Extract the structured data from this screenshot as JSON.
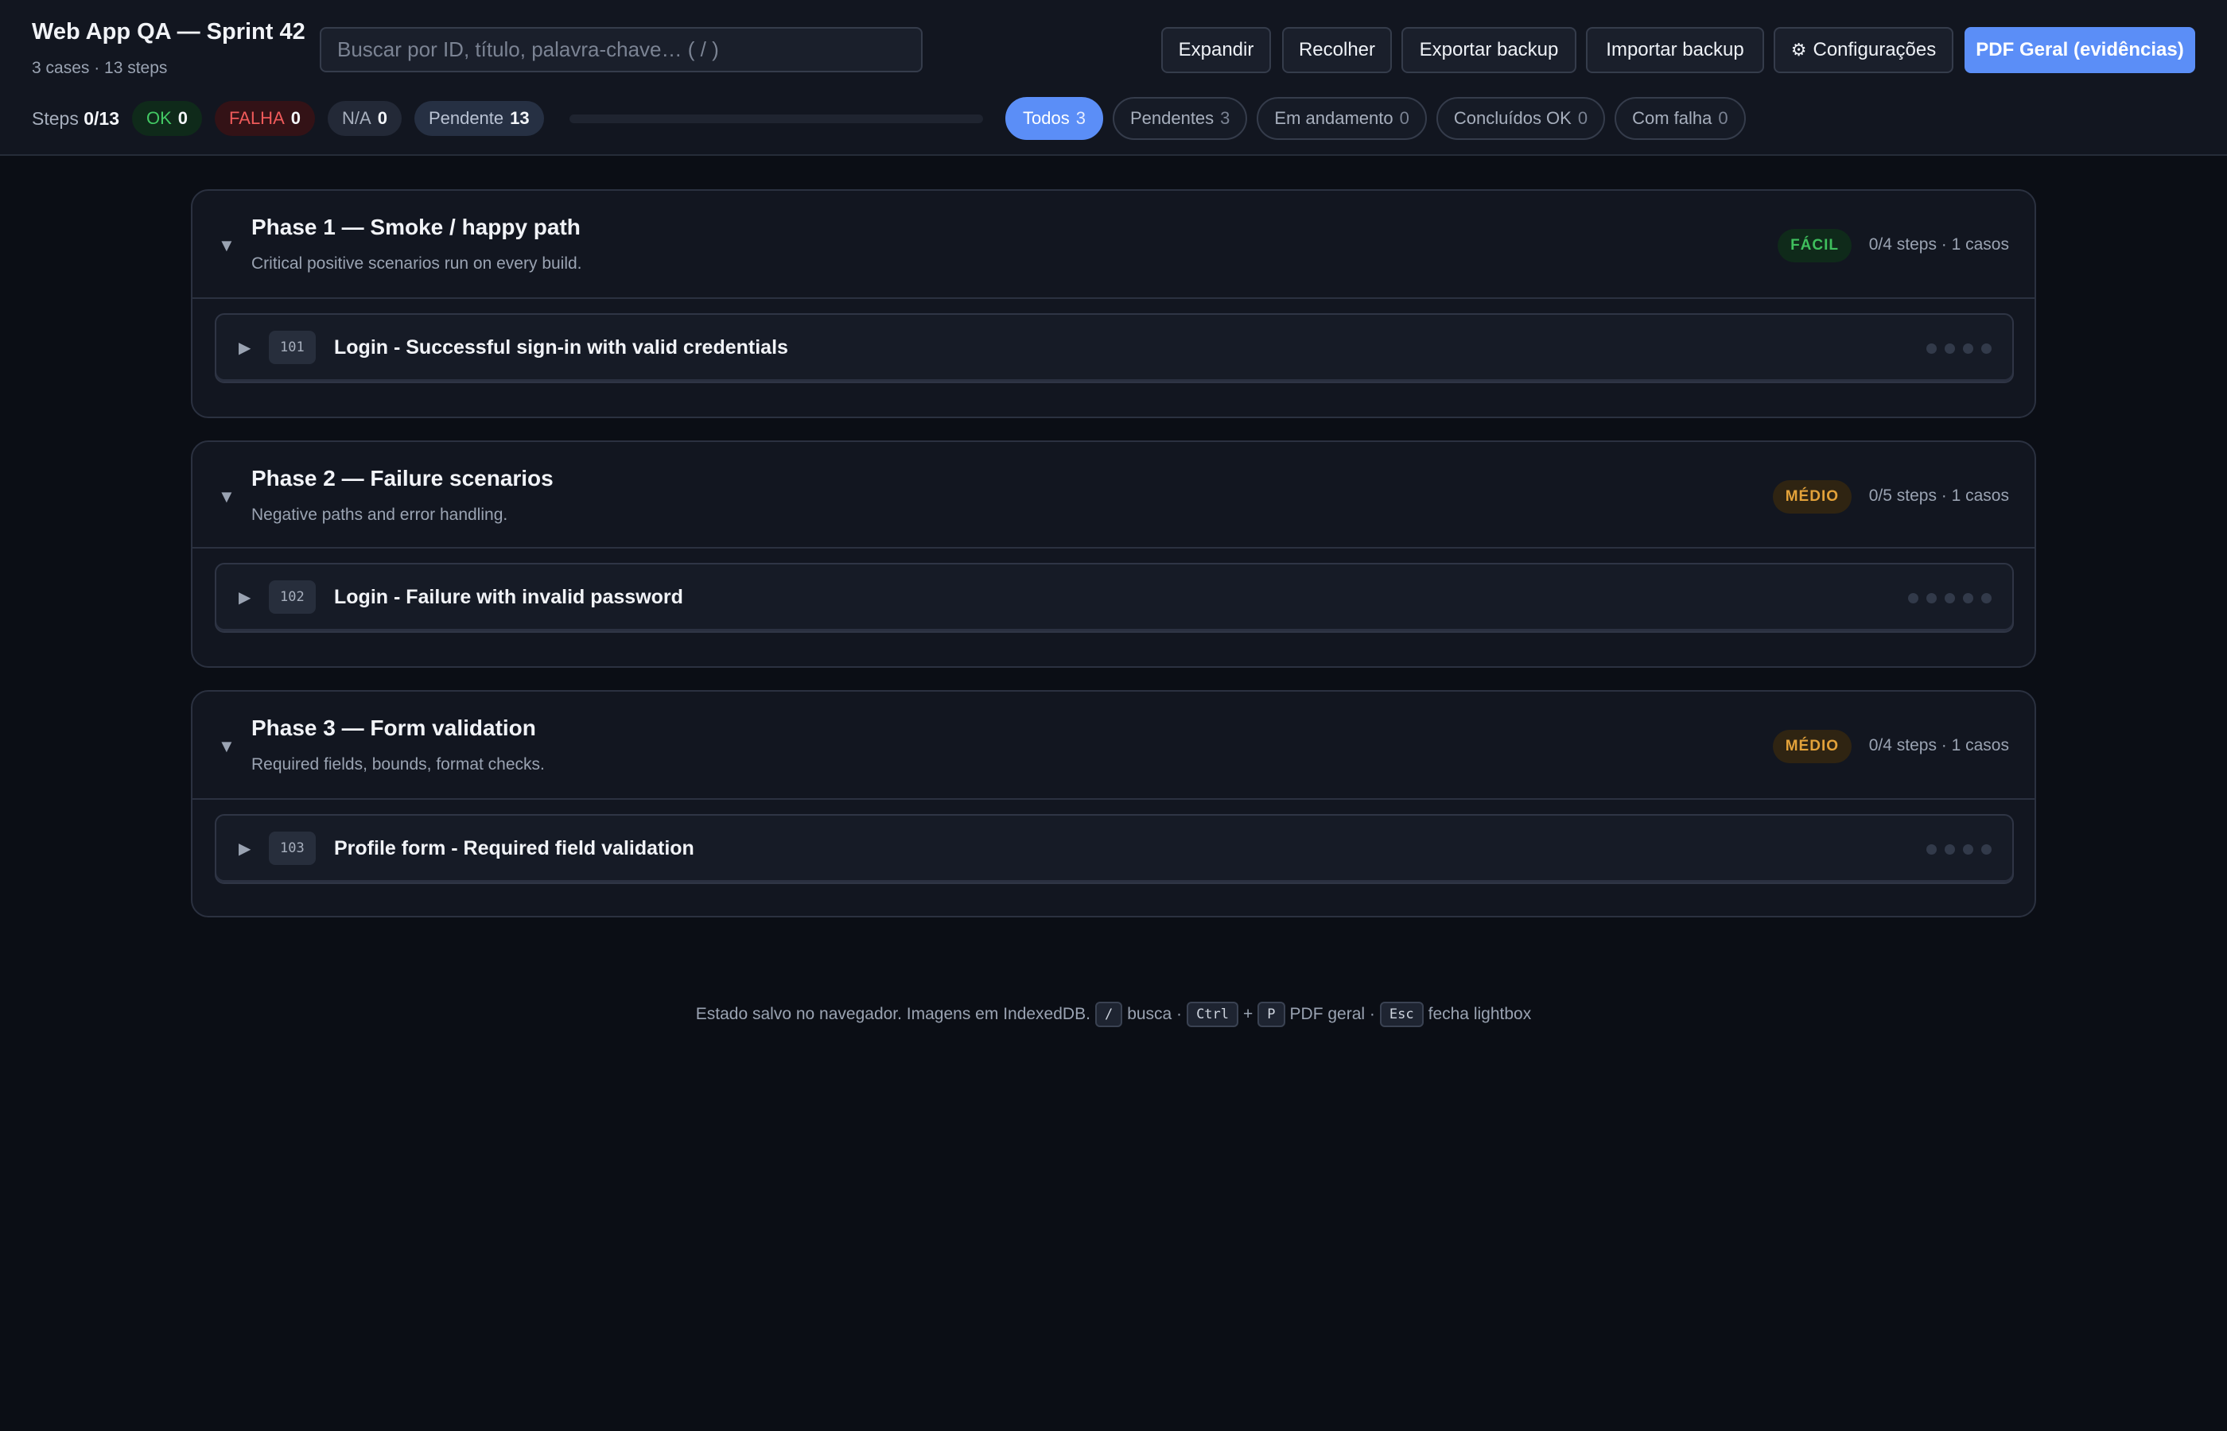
{
  "header": {
    "title": "Web App QA — Sprint 42",
    "subtitle": "3 cases · 13 steps",
    "search_placeholder": "Buscar por ID, título, palavra-chave… ( / )",
    "buttons": {
      "expand": "Expandir",
      "collapse": "Recolher",
      "export": "Exportar backup",
      "import": "Importar backup",
      "settings": "Configurações",
      "settings_icon": "gear-icon",
      "pdf": "PDF Geral (evidências)"
    }
  },
  "stats": {
    "steps_label": "Steps",
    "steps_done": "0",
    "steps_total": "13",
    "ok_label": "OK",
    "ok_count": "0",
    "fail_label": "FALHA",
    "fail_count": "0",
    "na_label": "N/A",
    "na_count": "0",
    "pending_label": "Pendente",
    "pending_count": "13",
    "progress_fraction": 0
  },
  "filters": [
    {
      "label": "Todos",
      "count": "3",
      "active": true
    },
    {
      "label": "Pendentes",
      "count": "3",
      "active": false
    },
    {
      "label": "Em andamento",
      "count": "0",
      "active": false
    },
    {
      "label": "Concluídos OK",
      "count": "0",
      "active": false
    },
    {
      "label": "Com falha",
      "count": "0",
      "active": false
    }
  ],
  "phases": [
    {
      "title": "Phase 1 — Smoke / happy path",
      "description": "Critical positive scenarios run on every build.",
      "difficulty": "FÁCIL",
      "meta": "0/4 steps · 1 casos",
      "case": {
        "id": "101",
        "title": "Login - Successful sign-in with valid credentials",
        "steps": 4
      }
    },
    {
      "title": "Phase 2 — Failure scenarios",
      "description": "Negative paths and error handling.",
      "difficulty": "MÉDIO",
      "meta": "0/5 steps · 1 casos",
      "case": {
        "id": "102",
        "title": "Login - Failure with invalid password",
        "steps": 5
      }
    },
    {
      "title": "Phase 3 — Form validation",
      "description": "Required fields, bounds, format checks.",
      "difficulty": "MÉDIO",
      "meta": "0/4 steps · 1 casos",
      "case": {
        "id": "103",
        "title": "Profile form - Required field validation",
        "steps": 4
      }
    }
  ],
  "footer": {
    "text1": "Estado salvo no navegador. Imagens em IndexedDB.",
    "kbd_search": "/",
    "text2": "busca ·",
    "kbd_ctrl": "Ctrl",
    "plus": "+",
    "kbd_p": "P",
    "text3": "PDF geral ·",
    "kbd_esc": "Esc",
    "text4": "fecha lightbox"
  }
}
